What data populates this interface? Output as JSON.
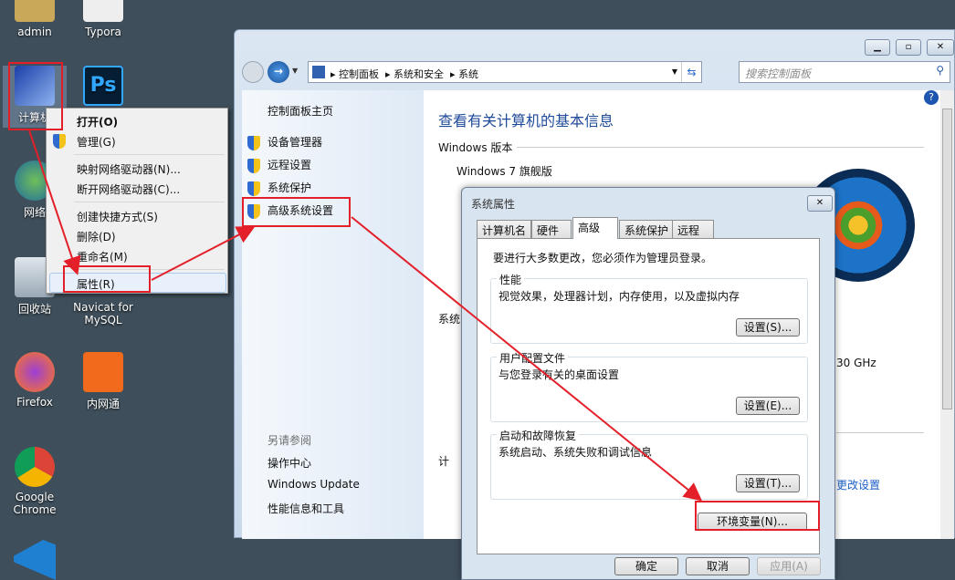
{
  "desktop": {
    "icons": [
      {
        "label": "admin"
      },
      {
        "label": "Typora"
      },
      {
        "label": "计算机"
      },
      {
        "label": "网络"
      },
      {
        "label": "回收站"
      },
      {
        "label": "Navicat for MySQL"
      },
      {
        "label": "Firefox"
      },
      {
        "label": "内网通"
      },
      {
        "label": "Google Chrome"
      }
    ]
  },
  "context_menu": {
    "items": [
      "打开(O)",
      "管理(G)",
      "映射网络驱动器(N)...",
      "断开网络驱动器(C)...",
      "创建快捷方式(S)",
      "删除(D)",
      "重命名(M)",
      "属性(R)"
    ]
  },
  "window": {
    "breadcrumb": [
      "控制面板",
      "系统和安全",
      "系统"
    ],
    "search_placeholder": "搜索控制面板",
    "left": {
      "home": "控制面板主页",
      "tasks": [
        "设备管理器",
        "远程设置",
        "系统保护",
        "高级系统设置"
      ],
      "see_also": "另请参阅",
      "see_also_links": [
        "操作中心",
        "Windows Update",
        "性能信息和工具"
      ]
    },
    "main": {
      "title": "查看有关计算机的基本信息",
      "edition_header": "Windows 版本",
      "edition": "Windows 7 旗舰版",
      "partial_sys": "系统",
      "partial_ghz": "30 GHz",
      "partial_comp": "计",
      "change_settings": "更改设置"
    }
  },
  "dialog": {
    "title": "系统属性",
    "tabs": [
      "计算机名",
      "硬件",
      "高级",
      "系统保护",
      "远程"
    ],
    "active_tab": "高级",
    "notice": "要进行大多数更改，您必须作为管理员登录。",
    "groups": [
      {
        "label": "性能",
        "desc": "视觉效果，处理器计划，内存使用，以及虚拟内存",
        "button": "设置(S)..."
      },
      {
        "label": "用户配置文件",
        "desc": "与您登录有关的桌面设置",
        "button": "设置(E)..."
      },
      {
        "label": "启动和故障恢复",
        "desc": "系统启动、系统失败和调试信息",
        "button": "设置(T)..."
      }
    ],
    "env_button": "环境变量(N)...",
    "ok": "确定",
    "cancel": "取消",
    "apply": "应用(A)"
  },
  "colors": {
    "annotation": "#e3202a",
    "link": "#1e3287",
    "title": "#1e4a9a"
  }
}
